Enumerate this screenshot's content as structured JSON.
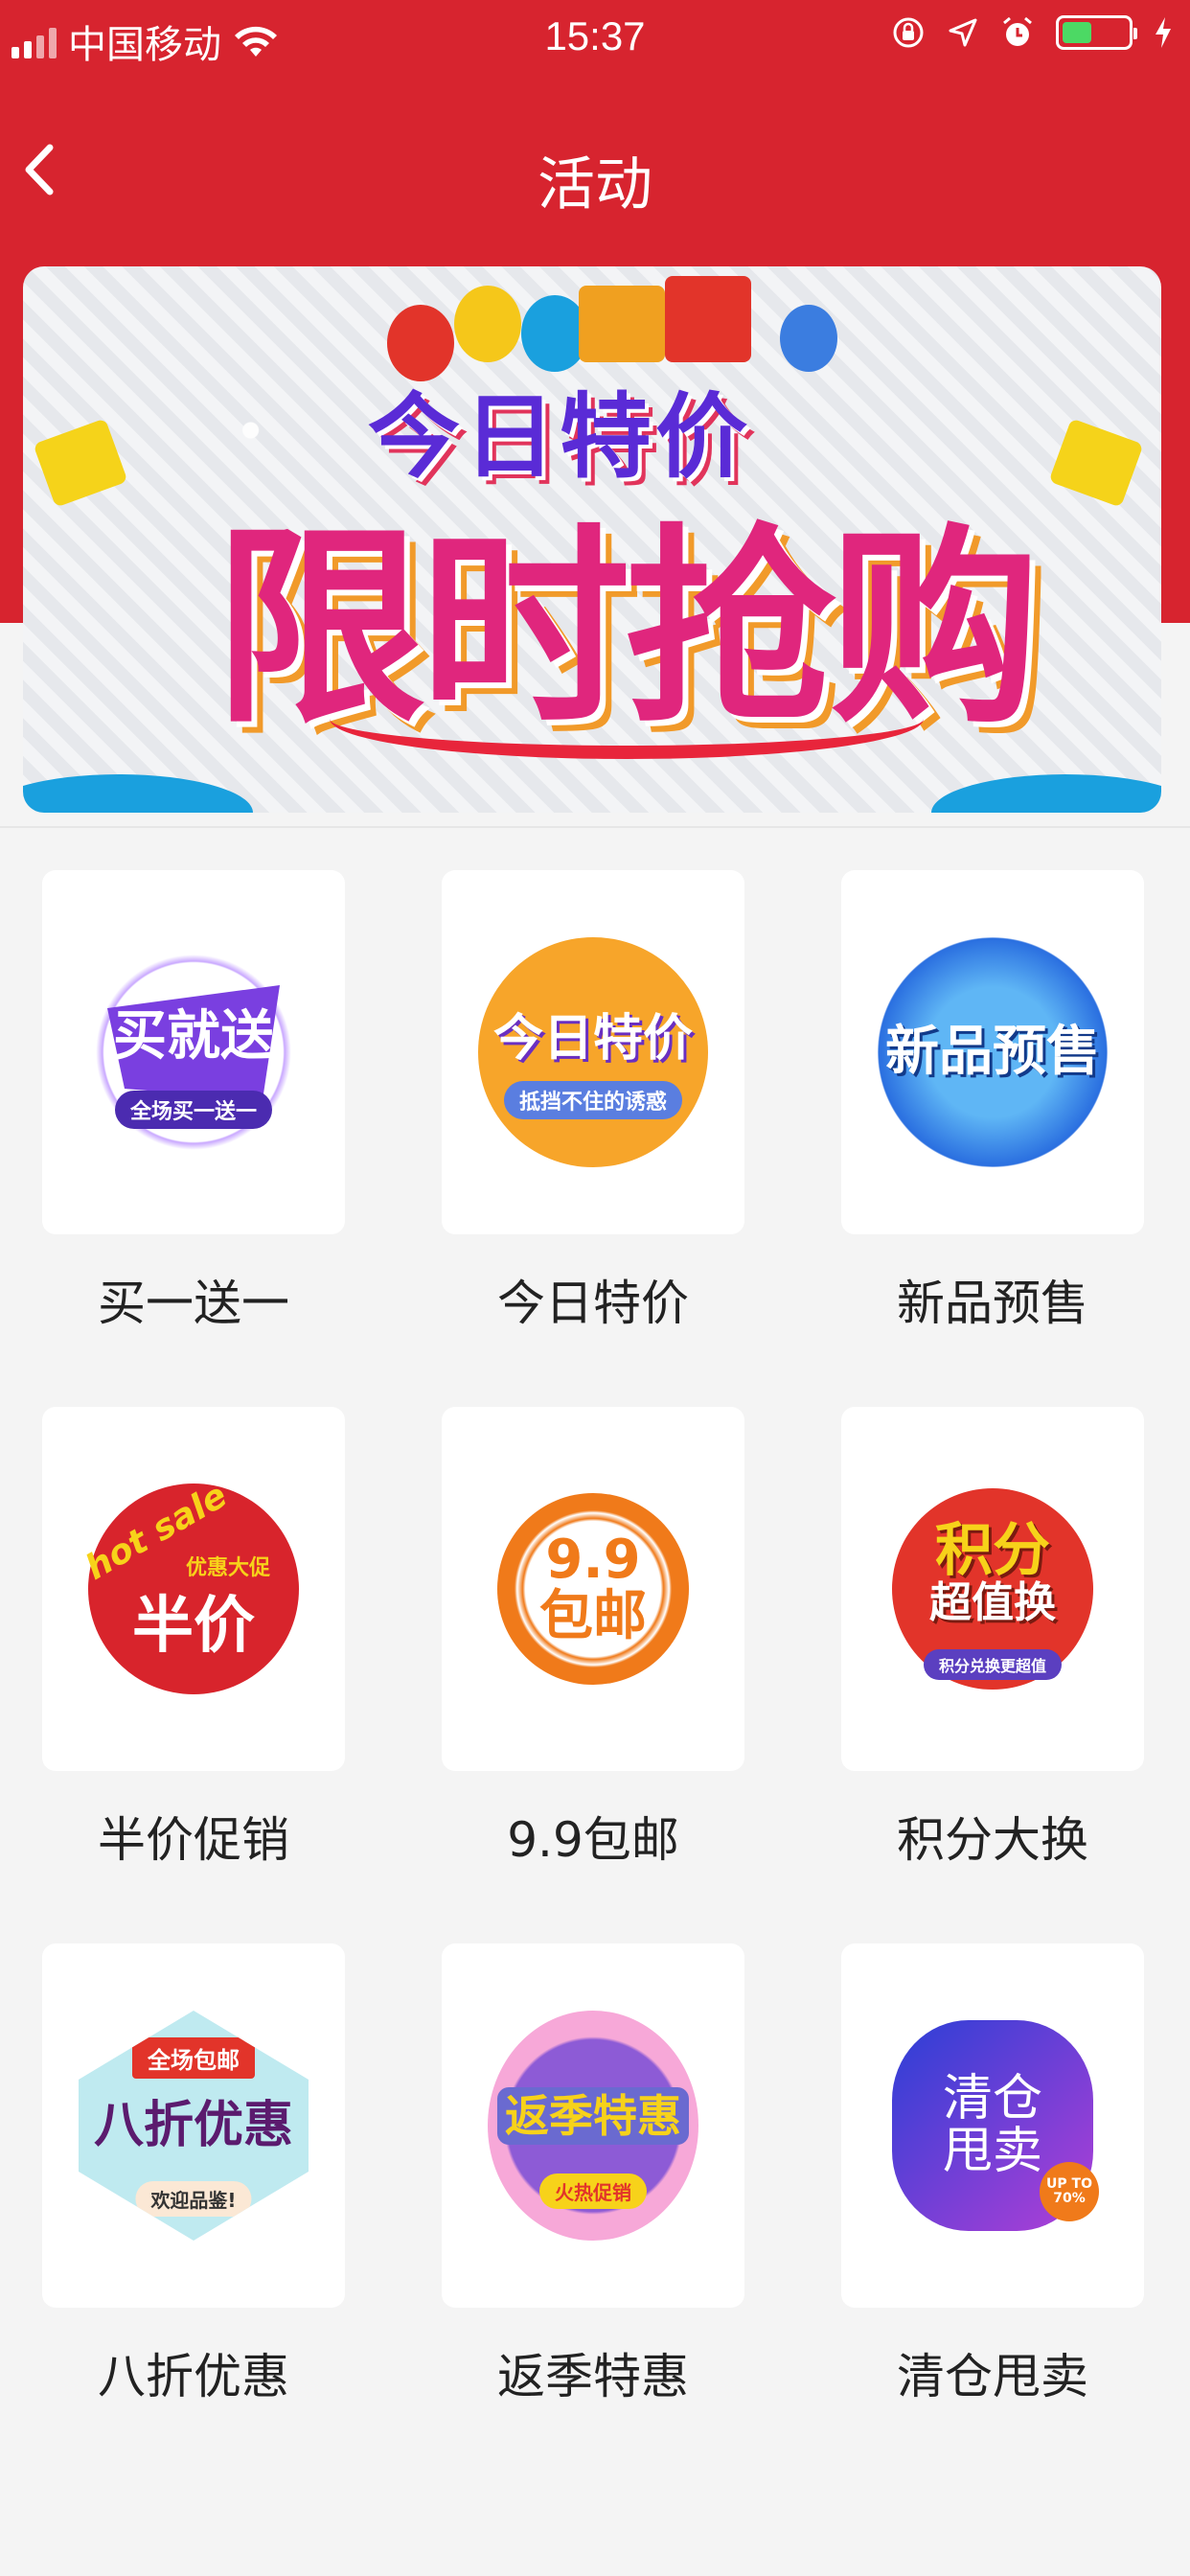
{
  "status_bar": {
    "carrier": "中国移动",
    "time": "15:37",
    "battery_level": 0.45
  },
  "nav": {
    "title": "活动"
  },
  "banner": {
    "line1": "今日特价",
    "line2": "限时抢购"
  },
  "activities": [
    {
      "label": "买一送一",
      "icon": "buy-one-get-one-icon",
      "badge_main": "买就送",
      "badge_sub": "全场买一送一",
      "color": "#7a3fe0"
    },
    {
      "label": "今日特价",
      "icon": "daily-special-icon",
      "badge_main": "今日特价",
      "badge_sub": "抵挡不住的诱惑",
      "color": "#f7a52a"
    },
    {
      "label": "新品预售",
      "icon": "new-presale-icon",
      "badge_main": "新品预售",
      "badge_sub": "",
      "color": "#2a6fe0"
    },
    {
      "label": "半价促销",
      "icon": "half-price-icon",
      "badge_main": "半价",
      "badge_sub": "优惠大促",
      "badge_extra": "hot sale",
      "color": "#d8242c"
    },
    {
      "label": "9.9包邮",
      "icon": "free-shipping-icon",
      "badge_main": "9.9",
      "badge_sub": "包邮",
      "color": "#f07a1a"
    },
    {
      "label": "积分大换",
      "icon": "points-exchange-icon",
      "badge_main": "积分",
      "badge_sub": "超值换",
      "badge_extra": "积分兑换更超值",
      "color": "#e2342a"
    },
    {
      "label": "八折优惠",
      "icon": "twenty-off-icon",
      "badge_main": "八折优惠",
      "badge_sub": "欢迎品鉴!",
      "badge_extra": "全场包邮",
      "color": "#5b1b6e"
    },
    {
      "label": "返季特惠",
      "icon": "off-season-icon",
      "badge_main": "返季特惠",
      "badge_sub": "火热促销",
      "color": "#8d5bd6"
    },
    {
      "label": "清仓甩卖",
      "icon": "clearance-icon",
      "badge_main": "清仓",
      "badge_sub": "甩卖",
      "badge_extra": "UP TO 70%",
      "color": "#3b3fd6"
    }
  ]
}
